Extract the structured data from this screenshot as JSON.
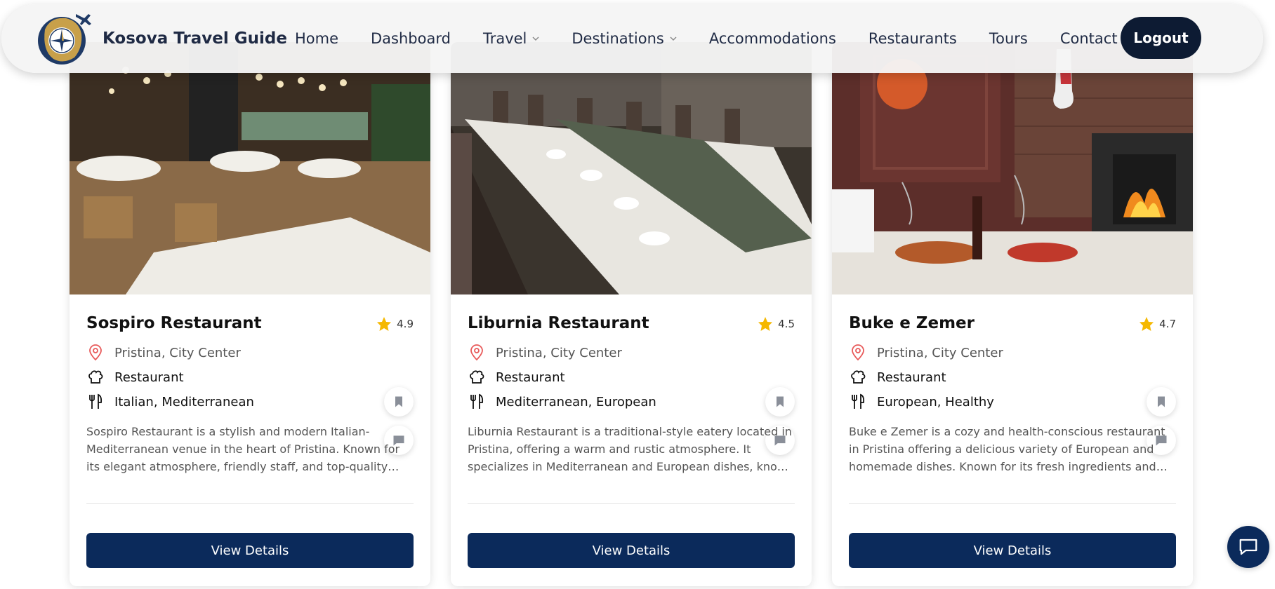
{
  "nav": {
    "brand": "Kosova Travel Guide",
    "links": [
      {
        "label": "Home",
        "dropdown": false
      },
      {
        "label": "Dashboard",
        "dropdown": false
      },
      {
        "label": "Travel",
        "dropdown": true
      },
      {
        "label": "Destinations",
        "dropdown": true
      },
      {
        "label": "Accommodations",
        "dropdown": false
      },
      {
        "label": "Restaurants",
        "dropdown": false
      },
      {
        "label": "Tours",
        "dropdown": false
      },
      {
        "label": "Contact",
        "dropdown": false
      }
    ],
    "logout_label": "Logout"
  },
  "cards": [
    {
      "title": "Sospiro Restaurant",
      "rating": "4.9",
      "location": "Pristina, City Center",
      "type": "Restaurant",
      "cuisine": "Italian, Mediterranean",
      "description": "Sospiro Restaurant is a stylish and modern Italian-Mediterranean venue in the heart of Pristina. Known for its elegant atmosphere, friendly staff, and top-quality dishes like homemade pasta and fresh seafood.",
      "button_label": "View Details"
    },
    {
      "title": "Liburnia Restaurant",
      "rating": "4.5",
      "location": "Pristina, City Center",
      "type": "Restaurant",
      "cuisine": "Mediterranean, European",
      "description": "Liburnia Restaurant is a traditional-style eatery located in Pristina, offering a warm and rustic atmosphere. It specializes in Mediterranean and European dishes, known for great food and hospitality.",
      "button_label": "View Details"
    },
    {
      "title": "Buke e Zemer",
      "rating": "4.7",
      "location": "Pristina, City Center",
      "type": "Restaurant",
      "cuisine": "European, Healthy",
      "description": "Buke e Zemer is a cozy and health-conscious restaurant in Pristina offering a delicious variety of European and homemade dishes. Known for its fresh ingredients and welcoming atmosphere.",
      "button_label": "View Details"
    }
  ],
  "colors": {
    "navy": "#0b2a5b",
    "dark_navy": "#0d1b33",
    "star": "#f5b800",
    "pin": "#e85a5a"
  },
  "icons": {
    "location": "map-pin-icon",
    "type": "chef-hat-icon",
    "cuisine": "fork-knife-icon",
    "rating": "star-icon",
    "bookmark": "bookmark-icon",
    "comment": "comment-icon",
    "chat": "chat-icon"
  }
}
